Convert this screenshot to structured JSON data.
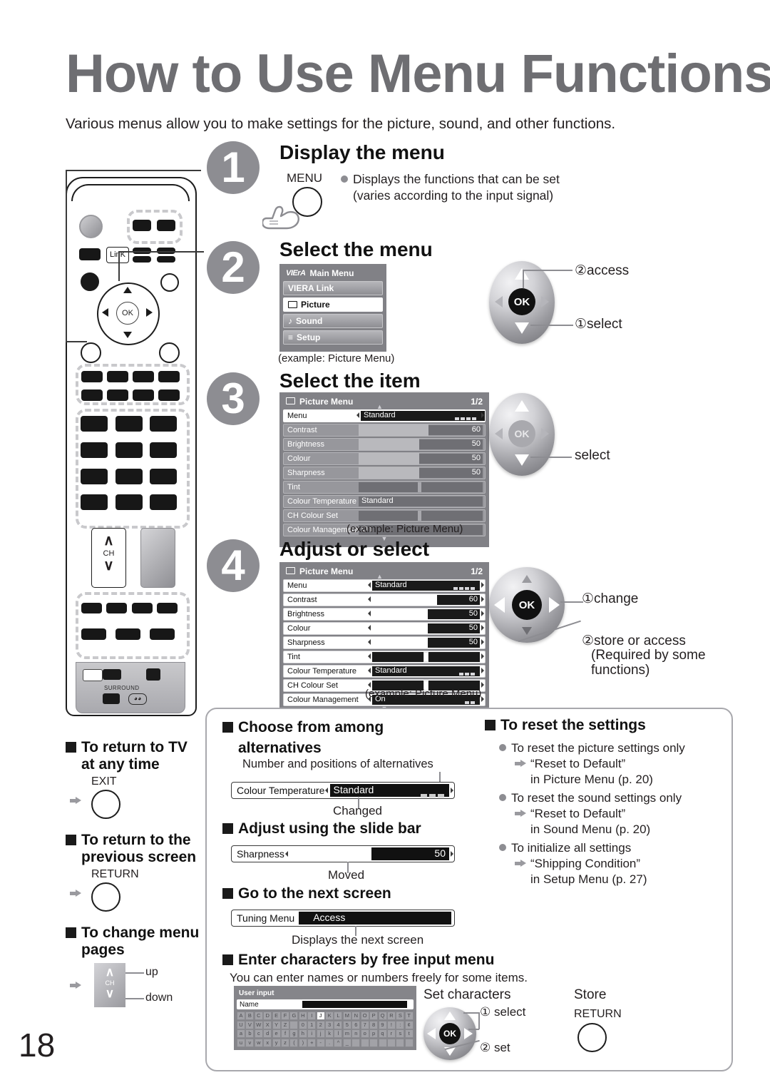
{
  "page": {
    "title": "How to Use Menu Functions",
    "intro": "Various menus allow you to make settings for the picture, sound, and other functions.",
    "number": "18"
  },
  "steps": [
    {
      "num": "1",
      "heading": "Display the menu",
      "button_label": "MENU",
      "bullet_line1": "Displays the functions that can be set",
      "bullet_line2": "(varies according to the input signal)"
    },
    {
      "num": "2",
      "heading": "Select the menu",
      "caption": "(example: Picture Menu)",
      "pad_labels": {
        "access": "②access",
        "select": "①select"
      }
    },
    {
      "num": "3",
      "heading": "Select the item",
      "caption": "(example: Picture Menu)",
      "pad_labels": {
        "select": "select"
      }
    },
    {
      "num": "4",
      "heading": "Adjust or select",
      "caption": "(example: Picture Menu)",
      "pad_labels": {
        "change": "①change",
        "store": "②store or access",
        "store_note1": "(Required by some",
        "store_note2": "functions)"
      }
    }
  ],
  "main_menu": {
    "logo": "VIErA",
    "title": "Main Menu",
    "items": [
      {
        "label": "VIERA Link",
        "icon": "",
        "selected": false
      },
      {
        "label": "Picture",
        "icon": "screen-icon",
        "selected": true
      },
      {
        "label": "Sound",
        "icon": "note-icon",
        "selected": false
      },
      {
        "label": "Setup",
        "icon": "list-icon",
        "selected": false
      }
    ]
  },
  "picture_menu": {
    "title": "Picture Menu",
    "page": "1/2",
    "rows": [
      {
        "label": "Menu",
        "type": "choice",
        "value": "Standard",
        "dots": 4,
        "selected": true
      },
      {
        "label": "Contrast",
        "type": "slider",
        "value": "60",
        "fill": 58
      },
      {
        "label": "Brightness",
        "type": "slider",
        "value": "50",
        "fill": 50
      },
      {
        "label": "Colour",
        "type": "slider",
        "value": "50",
        "fill": 50
      },
      {
        "label": "Sharpness",
        "type": "slider",
        "value": "50",
        "fill": 50
      },
      {
        "label": "Tint",
        "type": "knob",
        "value": "",
        "fill": 50
      },
      {
        "label": "Colour Temperature",
        "type": "choice",
        "value": "Standard",
        "dots": 3
      },
      {
        "label": "CH Colour Set",
        "type": "knob",
        "value": "",
        "fill": 50
      },
      {
        "label": "Colour Management",
        "type": "choice",
        "value": "On",
        "dots": 2
      }
    ]
  },
  "remote_notes": [
    {
      "heading_line1": "To return to TV",
      "heading_line2": "at any time",
      "button": "EXIT"
    },
    {
      "heading_line1": "To return to the",
      "heading_line2": "previous screen",
      "button": "RETURN"
    },
    {
      "heading_line1": "To change menu",
      "heading_line2": "pages",
      "button": "CH",
      "up": "up",
      "down": "down"
    }
  ],
  "remote": {
    "link_label": "LinK",
    "ch_label": "CH",
    "surround_label": "SURROUND"
  },
  "tips": {
    "choose": {
      "heading_line1": "Choose from among",
      "heading_line2": "alternatives",
      "note_top": "Number and positions of alternatives",
      "note_bottom": "Changed",
      "row_label": "Colour Temperature",
      "row_value": "Standard"
    },
    "slider": {
      "heading": "Adjust using the slide bar",
      "row_label": "Sharpness",
      "row_value": "50",
      "note_bottom": "Moved"
    },
    "next_screen": {
      "heading": "Go to the next screen",
      "row_label": "Tuning Menu",
      "row_value": "Access",
      "note_bottom": "Displays the next screen"
    },
    "free_input": {
      "heading": "Enter characters by free input menu",
      "subtext": "You can enter names or numbers freely for some items.",
      "set_characters_label": "Set characters",
      "store_label": "Store",
      "return_button": "RETURN",
      "pad_labels": {
        "select": "① select",
        "set": "② set"
      }
    },
    "reset": {
      "heading": "To reset the settings",
      "items": [
        {
          "bullet": "To reset the picture settings only",
          "arrow_line1": "“Reset to Default”",
          "arrow_line2": "in Picture Menu (p. 20)"
        },
        {
          "bullet": "To reset the sound settings only",
          "arrow_line1": "“Reset to Default”",
          "arrow_line2": "in Sound Menu (p. 20)"
        },
        {
          "bullet": "To initialize all settings",
          "arrow_line1": "“Shipping Condition”",
          "arrow_line2": "in Setup Menu (p. 27)"
        }
      ]
    }
  },
  "user_input": {
    "title": "User input",
    "name_label": "Name",
    "keyboard_rows": [
      [
        "A",
        "B",
        "C",
        "D",
        "E",
        "F",
        "G",
        "H",
        "I",
        "J",
        "K",
        "L",
        "M",
        "N",
        "O",
        "P",
        "Q",
        "R",
        "S",
        "T"
      ],
      [
        "U",
        "V",
        "W",
        "X",
        "Y",
        "Z",
        "",
        "0",
        "1",
        "2",
        "3",
        "4",
        "5",
        "6",
        "7",
        "8",
        "9",
        "!",
        ":",
        "¢"
      ],
      [
        "a",
        "b",
        "c",
        "d",
        "e",
        "f",
        "g",
        "h",
        "i",
        "j",
        "k",
        "l",
        "m",
        "n",
        "o",
        "p",
        "q",
        "r",
        "s",
        "t"
      ],
      [
        "u",
        "v",
        "w",
        "x",
        "y",
        "z",
        "(",
        ")",
        "+",
        "-",
        ".",
        "^",
        "_",
        "",
        "",
        "",
        "",
        "",
        "",
        ""
      ]
    ],
    "selected_key": "J"
  }
}
